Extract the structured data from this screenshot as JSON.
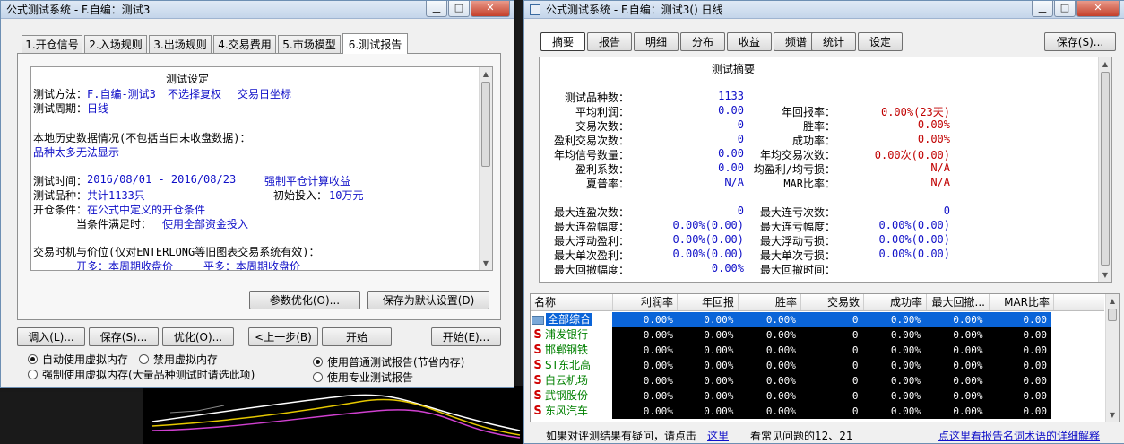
{
  "left": {
    "title": "公式测试系统 - F.自编：测试3",
    "tabs": [
      "1.开仓信号",
      "2.入场规则",
      "3.出场规则",
      "4.交易费用",
      "5.市场模型",
      "6.测试报告"
    ],
    "settings_heading": "测试设定",
    "lines": {
      "method_label": "测试方法：",
      "method_value": "F.自编-测试3",
      "method_fq": "不选择复权",
      "method_coord": "交易日坐标",
      "period_label": "测试周期：",
      "period_value": "日线",
      "history_label": "本地历史数据情况(不包括当日未收盘数据)：",
      "history_value": "品种太多无法显示",
      "time_label": "测试时间：",
      "time_value": "2016/08/01 - 2016/08/23",
      "force_close": "强制平仓计算收益",
      "varieties_label": "测试品种：",
      "varieties_value": "共计1133只",
      "invest_label": "初始投入：",
      "invest_value": "10万元",
      "open_label": "开仓条件：",
      "open_value": "在公式中定义的开仓条件",
      "satisfy_label": "当条件满足时：",
      "satisfy_value": "使用全部资金投入",
      "timing_label": "交易时机与价位(仅对ENTERLONG等旧图表交易系统有效)：",
      "open_long": "开多：本周期收盘价",
      "close_long": "平多：本周期收盘价"
    },
    "param_opt_button": "参数优化(O)...",
    "save_default_button": "保存为默认设置(D)",
    "bottom_buttons": [
      "调入(L)...",
      "保存(S)...",
      "优化(O)...",
      "<上一步(B)",
      "开始",
      "开始(E)..."
    ],
    "radios": {
      "auto_vmem": "自动使用虚拟内存",
      "no_vmem": "禁用虚拟内存",
      "force_vmem": "强制使用虚拟内存(大量品种测试时请选此项)",
      "normal_report": "使用普通测试报告(节省内存)",
      "pro_report": "使用专业测试报告"
    }
  },
  "right": {
    "title": "公式测试系统 - F.自编：测试3() 日线",
    "tabs": [
      "摘要",
      "报告",
      "明细",
      "分布",
      "收益",
      "频谱",
      "统计",
      "设定"
    ],
    "save_button": "保存(S)...",
    "summary_title": "测试摘要",
    "summary_left": [
      {
        "label": "测试品种数：",
        "value": "1133"
      },
      {
        "label": "平均利润：",
        "value": "0.00"
      },
      {
        "label": "交易次数：",
        "value": "0"
      },
      {
        "label": "盈利交易次数：",
        "value": "0"
      },
      {
        "label": "年均信号数量：",
        "value": "0.00"
      },
      {
        "label": "盈利系数：",
        "value": "0.00"
      },
      {
        "label": "夏普率：",
        "value": "N/A"
      }
    ],
    "summary_right": [
      {
        "label": "",
        "value": ""
      },
      {
        "label": "年回报率：",
        "value": "0.00%(23天)"
      },
      {
        "label": "胜率：",
        "value": "0.00%"
      },
      {
        "label": "成功率：",
        "value": "0.00%"
      },
      {
        "label": "年均交易次数：",
        "value": "0.00次(0.00)"
      },
      {
        "label": "均盈利/均亏损：",
        "value": "N/A"
      },
      {
        "label": "MAR比率：",
        "value": "N/A"
      }
    ],
    "streak_left": [
      {
        "label": "最大连盈次数：",
        "value": "0"
      },
      {
        "label": "最大连盈幅度：",
        "value": "0.00%(0.00)"
      },
      {
        "label": "最大浮动盈利：",
        "value": "0.00%(0.00)"
      },
      {
        "label": "最大单次盈利：",
        "value": "0.00%(0.00)"
      },
      {
        "label": "最大回撤幅度：",
        "value": "0.00%"
      }
    ],
    "streak_right": [
      {
        "label": "最大连亏次数：",
        "value": "0"
      },
      {
        "label": "最大连亏幅度：",
        "value": "0.00%(0.00)"
      },
      {
        "label": "最大浮动亏损：",
        "value": "0.00%(0.00)"
      },
      {
        "label": "最大单次亏损：",
        "value": "0.00%(0.00)"
      },
      {
        "label": "最大回撤时间：",
        "value": ""
      }
    ],
    "grid_headers": [
      "名称",
      "利润率",
      "年回报",
      "胜率",
      "交易数",
      "成功率",
      "最大回撤...",
      "MAR比率"
    ],
    "grid_rows": [
      {
        "name": "全部综合",
        "vals": [
          "0.00%",
          "0.00%",
          "0.00%",
          "0",
          "0.00%",
          "0.00%",
          "0.00"
        ]
      },
      {
        "name": "浦发银行",
        "vals": [
          "0.00%",
          "0.00%",
          "0.00%",
          "0",
          "0.00%",
          "0.00%",
          "0.00"
        ]
      },
      {
        "name": "邯郸钢铁",
        "vals": [
          "0.00%",
          "0.00%",
          "0.00%",
          "0",
          "0.00%",
          "0.00%",
          "0.00"
        ]
      },
      {
        "name": "ST东北高",
        "vals": [
          "0.00%",
          "0.00%",
          "0.00%",
          "0",
          "0.00%",
          "0.00%",
          "0.00"
        ]
      },
      {
        "name": "白云机场",
        "vals": [
          "0.00%",
          "0.00%",
          "0.00%",
          "0",
          "0.00%",
          "0.00%",
          "0.00"
        ]
      },
      {
        "name": "武钢股份",
        "vals": [
          "0.00%",
          "0.00%",
          "0.00%",
          "0",
          "0.00%",
          "0.00%",
          "0.00"
        ]
      },
      {
        "name": "东风汽车",
        "vals": [
          "0.00%",
          "0.00%",
          "0.00%",
          "0",
          "0.00%",
          "0.00%",
          "0.00"
        ]
      }
    ],
    "footer_question": "如果对评测结果有疑问，请点击",
    "footer_here": "这里",
    "footer_common": "看常见问题的12、21",
    "footer_link": "点这里看报告名词术语的详细解释"
  },
  "colors": {
    "link_blue": "#1010c8",
    "value_red": "#c00000",
    "selected_row": "#0a64d8"
  }
}
